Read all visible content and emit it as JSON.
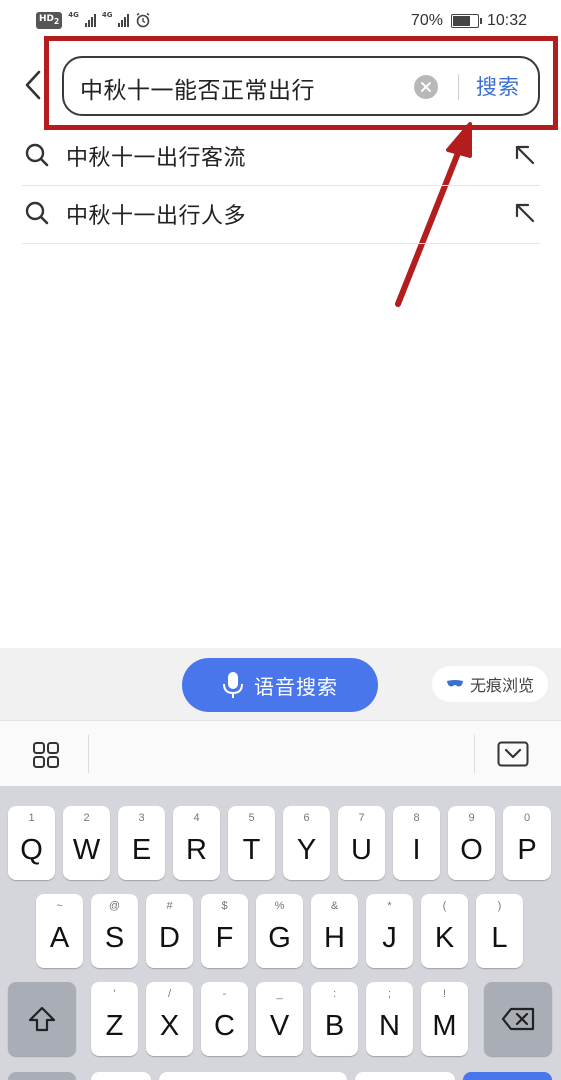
{
  "status_bar": {
    "battery": "70%",
    "time": "10:32",
    "hd": "HD",
    "sim": "2",
    "net1": "4G",
    "net2": "4G"
  },
  "search": {
    "query": "中秋十一能否正常出行",
    "button": "搜索"
  },
  "suggestions": [
    {
      "text": "中秋十一出行客流"
    },
    {
      "text": "中秋十一出行人多"
    }
  ],
  "voice_bar": {
    "voice_search": "语音搜索",
    "incognito": "无痕浏览"
  },
  "keyboard": {
    "row1": [
      {
        "hint": "1",
        "key": "Q"
      },
      {
        "hint": "2",
        "key": "W"
      },
      {
        "hint": "3",
        "key": "E"
      },
      {
        "hint": "4",
        "key": "R"
      },
      {
        "hint": "5",
        "key": "T"
      },
      {
        "hint": "6",
        "key": "Y"
      },
      {
        "hint": "7",
        "key": "U"
      },
      {
        "hint": "8",
        "key": "I"
      },
      {
        "hint": "9",
        "key": "O"
      },
      {
        "hint": "0",
        "key": "P"
      }
    ],
    "row2": [
      {
        "hint": "~",
        "key": "A"
      },
      {
        "hint": "@",
        "key": "S"
      },
      {
        "hint": "#",
        "key": "D"
      },
      {
        "hint": "$",
        "key": "F"
      },
      {
        "hint": "%",
        "key": "G"
      },
      {
        "hint": "&",
        "key": "H"
      },
      {
        "hint": "*",
        "key": "J"
      },
      {
        "hint": "(",
        "key": "K"
      },
      {
        "hint": ")",
        "key": "L"
      }
    ],
    "row3": [
      {
        "hint": "'",
        "key": "Z"
      },
      {
        "hint": "/",
        "key": "X"
      },
      {
        "hint": "-",
        "key": "C"
      },
      {
        "hint": "_",
        "key": "V"
      },
      {
        "hint": ":",
        "key": "B"
      },
      {
        "hint": ";",
        "key": "N"
      },
      {
        "hint": "!",
        "key": "M"
      }
    ]
  },
  "colors": {
    "accent": "#4a76ec",
    "search_button": "#3b6fd0",
    "annotation": "#b31d1d"
  }
}
